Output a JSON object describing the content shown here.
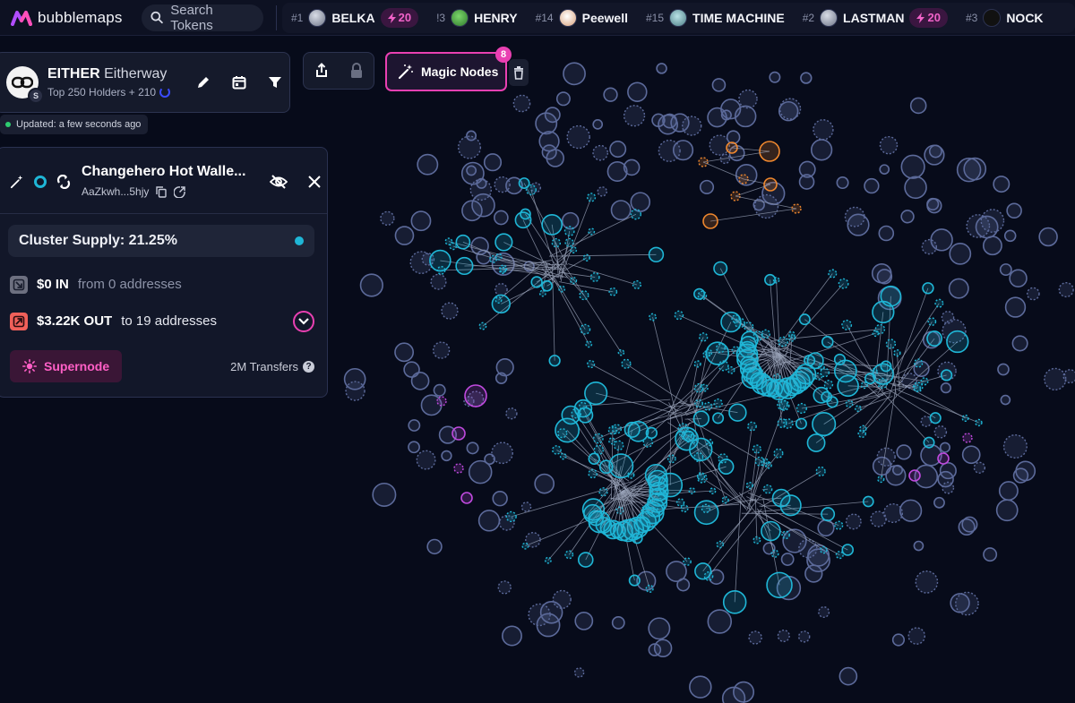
{
  "app": {
    "brand": "bubblemaps"
  },
  "search": {
    "label": "Search Tokens"
  },
  "tickers": [
    {
      "rank": "#1",
      "name": "BELKA",
      "boost": "20"
    },
    {
      "rank": "!3",
      "name": "HENRY",
      "boost": ""
    },
    {
      "rank": "#14",
      "name": "Peewell",
      "boost": ""
    },
    {
      "rank": "#15",
      "name": "TIME MACHINE",
      "boost": ""
    },
    {
      "rank": "#2",
      "name": "LASTMAN",
      "boost": "20"
    },
    {
      "rank": "#3",
      "name": "NOCK",
      "boost": ""
    }
  ],
  "token": {
    "symbol": "EITHER",
    "name": "Eitherway",
    "subtitle": "Top 250 Holders + 210",
    "chain_badge": "S"
  },
  "updated": "Updated: a few seconds ago",
  "toolbar": {
    "magic_label": "Magic Nodes",
    "magic_count": "8"
  },
  "wallet": {
    "title": "Changehero Hot Walle...",
    "address": "AaZkwh...5hjy",
    "cluster_supply": "Cluster Supply: 21.25%",
    "in_amount": "$0 IN",
    "in_detail": "from 0 addresses",
    "out_amount": "$3.22K OUT",
    "out_detail": "to 19 addresses",
    "supernode_label": "Supernode",
    "transfers": "2M Transfers"
  },
  "colors": {
    "accent": "#e940b2",
    "cluster": "#1fb6d6",
    "orange_cluster": "#f0882e",
    "purple_cluster": "#c04adf",
    "background": "#070b1a"
  }
}
